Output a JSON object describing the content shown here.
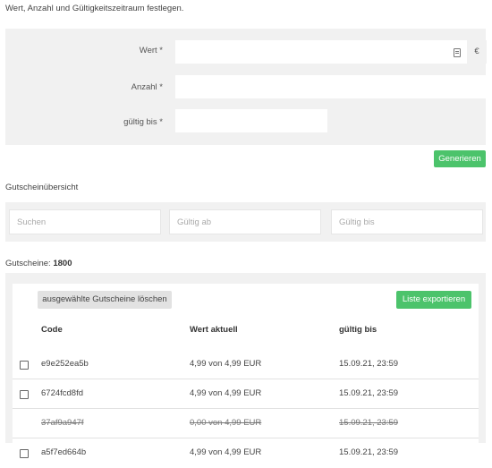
{
  "intro_text": "Wert, Anzahl und Gültigkeitszeitraum festlegen.",
  "form": {
    "wert_label": "Wert *",
    "anzahl_label": "Anzahl *",
    "gueltig_label": "gültig bis *",
    "currency": "€",
    "generate_label": "Generieren"
  },
  "overview": {
    "title": "Gutscheinübersicht",
    "search_placeholder": "Suchen",
    "valid_from_placeholder": "Gültig ab",
    "valid_to_placeholder": "Gültig bis"
  },
  "count": {
    "label": "Gutscheine:",
    "value": "1800"
  },
  "table": {
    "delete_label": "ausgewählte Gutscheine löschen",
    "export_label": "Liste exportieren",
    "headers": {
      "code": "Code",
      "value": "Wert aktuell",
      "valid": "gültig bis"
    },
    "rows": [
      {
        "code": "e9e252ea5b",
        "value": "4,99 von 4,99 EUR",
        "valid": "15.09.21, 23:59",
        "struck": false,
        "checkbox": true
      },
      {
        "code": "6724fcd8fd",
        "value": "4,99 von 4,99 EUR",
        "valid": "15.09.21, 23:59",
        "struck": false,
        "checkbox": true
      },
      {
        "code": "37af9a947f",
        "value": "0,00 von 4,99 EUR",
        "valid": "15.09.21, 23:59",
        "struck": true,
        "checkbox": false
      },
      {
        "code": "a5f7ed664b",
        "value": "4,99 von 4,99 EUR",
        "valid": "15.09.21, 23:59",
        "struck": false,
        "checkbox": true
      }
    ]
  },
  "colors": {
    "accent_green": "#4cc36b",
    "panel_grey": "#f1f1f1"
  }
}
